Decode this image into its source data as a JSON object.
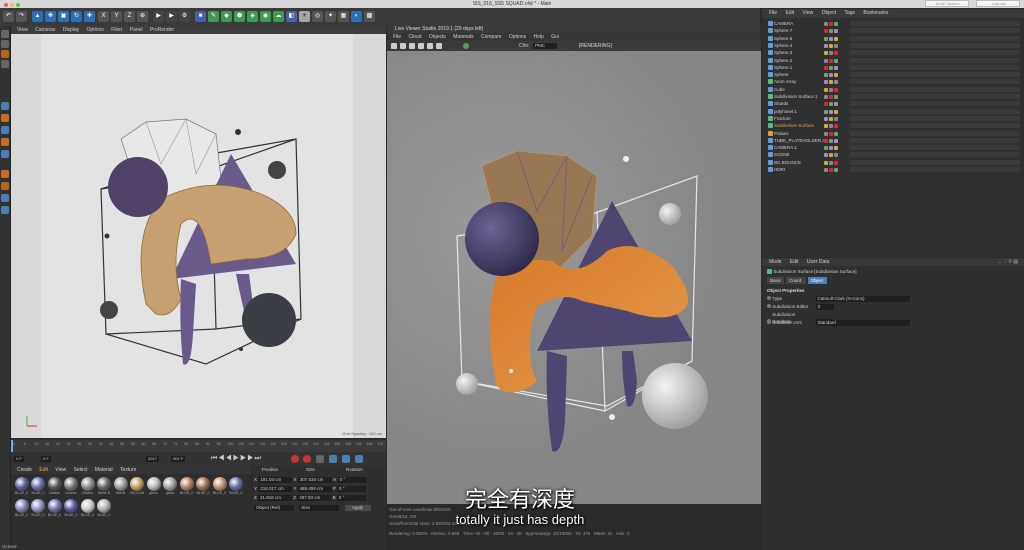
{
  "window": {
    "title": "SIS_016_SS5 SQUAD.c4d * - Main",
    "search_placeholder": "Node Spaces",
    "layout_label": "Layouts"
  },
  "viewport": {
    "menu": [
      "View",
      "Cameras",
      "Display",
      "Options",
      "Filter",
      "Panel",
      "ProRender"
    ],
    "grid_label": "Grid Spacing : 100 cm"
  },
  "timeline": {
    "ticks": [
      "0",
      "5",
      "10",
      "15",
      "20",
      "25",
      "30",
      "35",
      "40",
      "45",
      "50",
      "55",
      "60",
      "65",
      "70",
      "75",
      "80",
      "85",
      "90",
      "95",
      "100",
      "105",
      "110",
      "115",
      "120",
      "125",
      "130",
      "135",
      "140",
      "145",
      "150",
      "155",
      "160",
      "165",
      "170"
    ],
    "current_frame": "0 F",
    "start_field": "0 F",
    "end_field": "2017",
    "max_field": "301 F"
  },
  "materials": {
    "menu": [
      "Create",
      "Edit",
      "View",
      "Select",
      "Material",
      "Texture"
    ],
    "items": [
      {
        "label": "BLUE_0",
        "color": "#5a5f9a"
      },
      {
        "label": "BLUE_0",
        "color": "#6b6fa8"
      },
      {
        "label": "Octane",
        "color": "#555555"
      },
      {
        "label": "Octane",
        "color": "#777777"
      },
      {
        "label": "Octane",
        "color": "#8a8a8a"
      },
      {
        "label": "Noise B",
        "color": "#666666"
      },
      {
        "label": "Mat.B",
        "color": "#999999"
      },
      {
        "label": "YELLOW",
        "color": "#c0a060"
      },
      {
        "label": "glass",
        "color": "#b8b8b8"
      },
      {
        "label": "glass",
        "color": "#a0a0a0"
      },
      {
        "label": "BLUE_0",
        "color": "#b08060"
      },
      {
        "label": "BLUE_0",
        "color": "#a07050"
      },
      {
        "label": "BLUE_0",
        "color": "#c09070"
      },
      {
        "label": "BLUE_0",
        "color": "#6070a0"
      },
      {
        "label": "BLUE_0",
        "color": "#8080b8"
      },
      {
        "label": "BLUE_0",
        "color": "#9090c0"
      },
      {
        "label": "BLUE_0",
        "color": "#7070b0"
      },
      {
        "label": "BLUE_0",
        "color": "#5858a0"
      },
      {
        "label": "BLUE_0",
        "color": "#c8c8c8"
      },
      {
        "label": "BLUE_0",
        "color": "#b0b0b0"
      }
    ]
  },
  "coords": {
    "headers": [
      "Position",
      "Size",
      "Rotation"
    ],
    "rows": [
      {
        "axis": "X",
        "pos": "191.03 cm",
        "size_axis": "X",
        "size": "307.034 cm",
        "rot_axis": "H",
        "rot": "0 °"
      },
      {
        "axis": "Y",
        "pos": "218.017 cm",
        "size_axis": "Y",
        "size": "489.459 cm",
        "rot_axis": "P",
        "rot": "0 °"
      },
      {
        "axis": "Z",
        "pos": "31.816 cm",
        "size_axis": "Z",
        "size": "487.83 cm",
        "rot_axis": "B",
        "rot": "0 °"
      }
    ],
    "mode_pos": "Object (Rel)",
    "mode_size": "Size",
    "apply": "Apply"
  },
  "live_viewer": {
    "title": "Live Viewer Studio 2019.1 (29 days left)",
    "menu": [
      "File",
      "Cloud",
      "Objects",
      "Materials",
      "Compare",
      "Options",
      "Help",
      "Gui"
    ],
    "channel_label": "Chn:",
    "channel_value": "PMC",
    "status_label": "[RENDERING]",
    "status_lines": [
      "Out-of-core used/max:0kb/4Gb",
      "Grey8/16: 0/0",
      "Used/free/total vram: 2.58Gb/4.1Gb/8Gb"
    ],
    "render_stats": [
      "Rendering: 0.062%",
      "Ms/sec: 0.668",
      "Time: 00 : 00 : 16/00 : 44 : 20",
      "Spp/maxspp: 10/16000",
      "Tri: 47k",
      "Mesh: 31",
      "Hair: 0"
    ]
  },
  "object_manager": {
    "menu": [
      "File",
      "Edit",
      "View",
      "Object",
      "Tags",
      "Bookmarks"
    ],
    "objects": [
      {
        "name": "CAMERA",
        "color": "#5aa0e0",
        "highlight": false
      },
      {
        "name": "Sphere.7",
        "color": "#5aa0e0",
        "highlight": false
      },
      {
        "name": "Sphere.6",
        "color": "#5aa0e0",
        "highlight": false
      },
      {
        "name": "Sphere.4",
        "color": "#5aa0e0",
        "highlight": false
      },
      {
        "name": "Sphere.3",
        "color": "#5aa0e0",
        "highlight": false
      },
      {
        "name": "Sphere.2",
        "color": "#5aa0e0",
        "highlight": false
      },
      {
        "name": "Sphere.1",
        "color": "#5aa0e0",
        "highlight": false
      },
      {
        "name": "Sphere",
        "color": "#5aa0e0",
        "highlight": false
      },
      {
        "name": "Atom Array",
        "color": "#4ec07a",
        "highlight": false
      },
      {
        "name": "Cube",
        "color": "#5aa0e0",
        "highlight": false
      },
      {
        "name": "Subdivision Surface.1",
        "color": "#4ec07a",
        "highlight": false
      },
      {
        "name": "Shards",
        "color": "#5aa0e0",
        "highlight": false
      },
      {
        "name": "polyhimel.1",
        "color": "#5aa0e0",
        "highlight": false
      },
      {
        "name": "Fracture",
        "color": "#4ec07a",
        "highlight": false
      },
      {
        "name": "Subdivision Surface",
        "color": "#4ec07a",
        "highlight": true
      },
      {
        "name": "Polaxis",
        "color": "#e0a030",
        "highlight": false
      },
      {
        "name": "TUBE_PLATEHOLDER.3",
        "color": "#5aa0e0",
        "highlight": false
      },
      {
        "name": "CAMERA.1",
        "color": "#5aa0e0",
        "highlight": false
      },
      {
        "name": "SCENE",
        "color": "#5aa0e0",
        "highlight": false
      },
      {
        "name": "BG BOUNCE",
        "color": "#5aa0e0",
        "highlight": false
      },
      {
        "name": "HDRI",
        "color": "#5aa0e0",
        "highlight": false
      }
    ]
  },
  "attribute_manager": {
    "menu": [
      "Mode",
      "Edit",
      "User Data"
    ],
    "object_title": "Subdivision Surface [Subdivision Surface]",
    "tabs": [
      "Basic",
      "Coord.",
      "Object"
    ],
    "section": "Object Properties",
    "props": [
      {
        "label": "Type",
        "value": "Catmull-Clark (N-Gons)"
      },
      {
        "label": "Subdivision Editor",
        "value": "3"
      },
      {
        "label": "Subdivision Renderer",
        "value": "3"
      },
      {
        "label": "Subdivide UVs",
        "value": "Standard"
      }
    ]
  },
  "subtitles": {
    "chinese": "完全有深度",
    "english": "totally it just has depth"
  },
  "statusbar": {
    "text": "Octane:"
  }
}
